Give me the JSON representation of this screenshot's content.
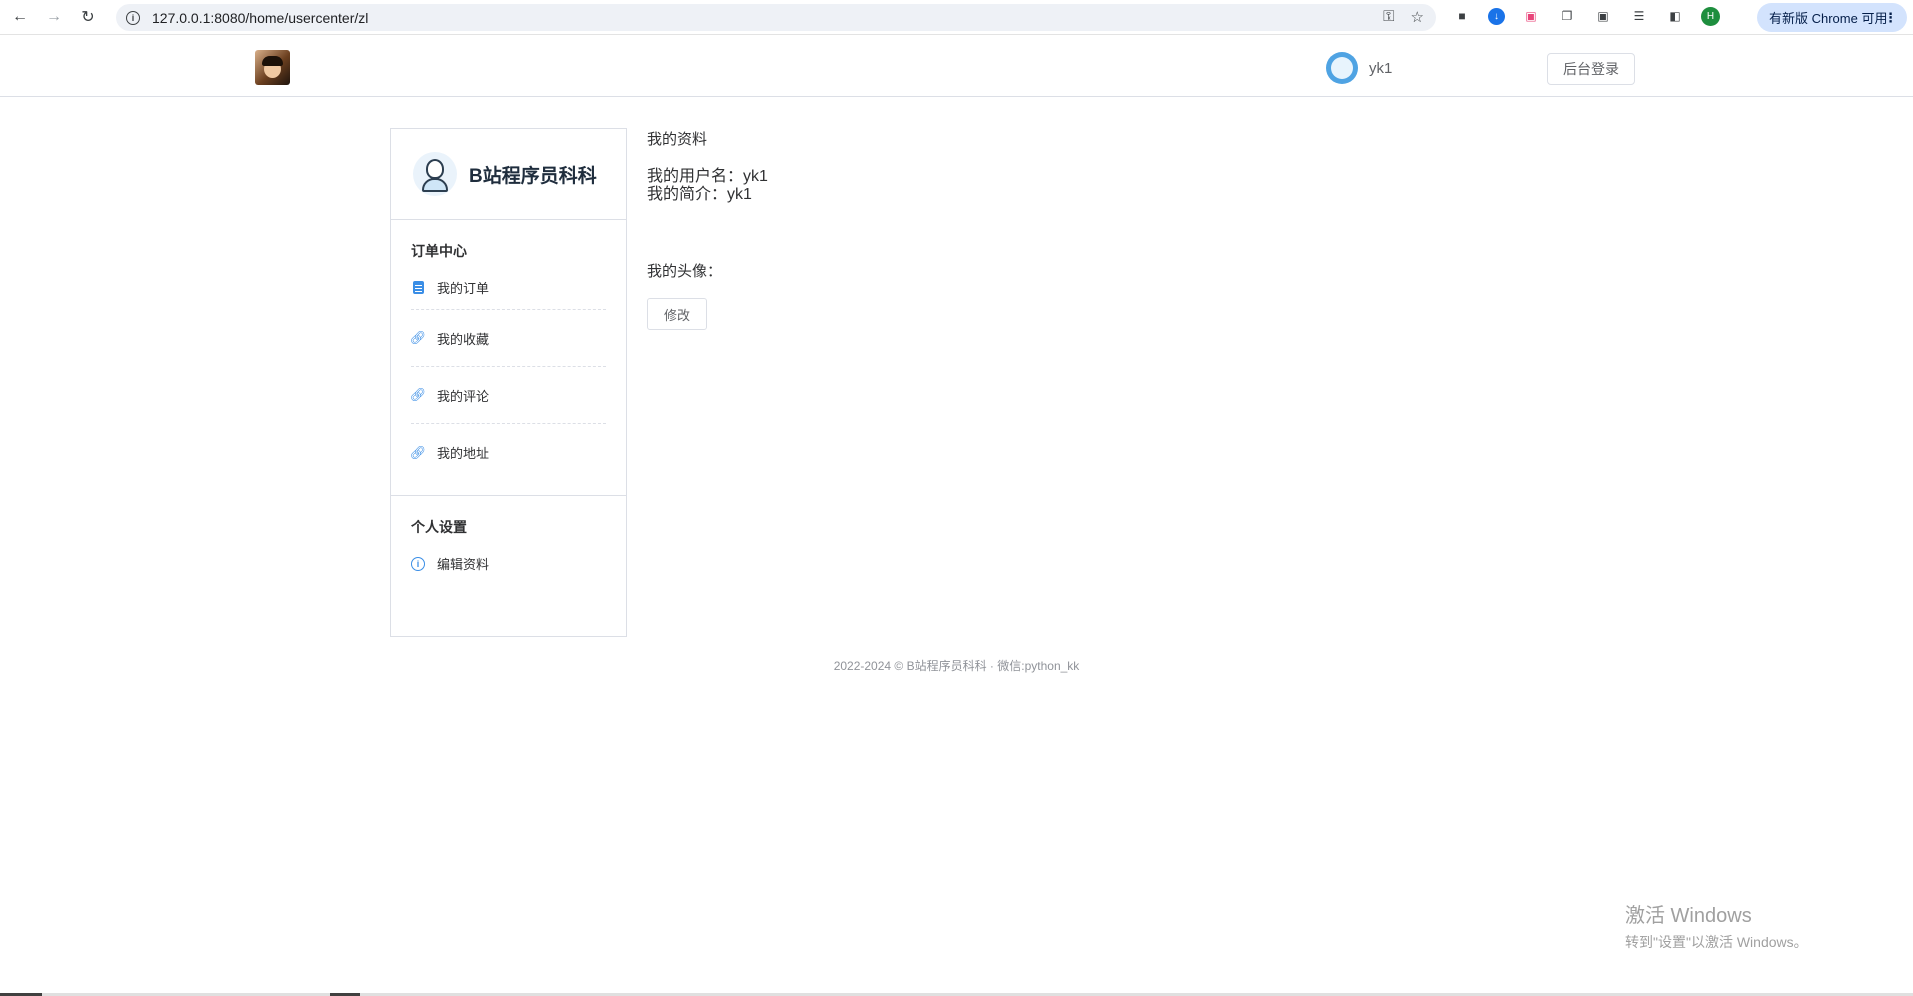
{
  "browser": {
    "url": "127.0.0.1:8080/home/usercenter/zl",
    "profile_initial": "H",
    "update_label": "有新版 Chrome 可用"
  },
  "header": {
    "username": "yk1",
    "admin_login": "后台登录"
  },
  "sidebar": {
    "brand": "B站程序员科科",
    "sections": [
      {
        "title": "订单中心",
        "items": [
          {
            "label": "我的订单",
            "icon": "clipboard-icon"
          },
          {
            "label": "我的收藏",
            "icon": "link-icon"
          },
          {
            "label": "我的评论",
            "icon": "link-icon"
          },
          {
            "label": "我的地址",
            "icon": "link-icon"
          }
        ]
      },
      {
        "title": "个人设置",
        "items": [
          {
            "label": "编辑资料",
            "icon": "info-circle-icon"
          }
        ]
      }
    ]
  },
  "main": {
    "title": "我的资料",
    "username_line": "我的用户名：yk1",
    "bio_line": "我的简介：yk1",
    "avatar_label": "我的头像：",
    "edit_button": "修改"
  },
  "footer": {
    "text": "2022-2024 © B站程序员科科 · 微信:python_kk"
  },
  "watermark": {
    "line1": "激活 Windows",
    "line2": "转到\"设置\"以激活 Windows。"
  }
}
